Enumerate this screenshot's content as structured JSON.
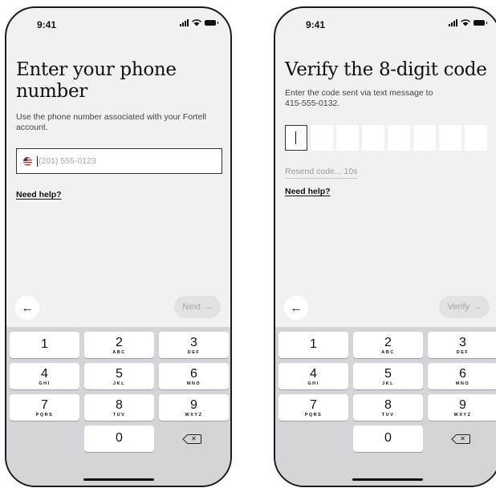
{
  "status": {
    "time": "9:41"
  },
  "screen1": {
    "title": "Enter your phone number",
    "subtitle": "Use the phone number associated with your Fortell account.",
    "flag_icon": "us-flag-icon",
    "phone_placeholder": "(201) 555-0123",
    "need_help": "Need help?",
    "back_icon": "←",
    "next_label": "Next",
    "next_arrow": "→"
  },
  "screen2": {
    "title": "Verify the 8-digit code",
    "subtitle_line1": "Enter the code sent via text message to",
    "subtitle_line2": "415-555-0132.",
    "code_boxes": [
      "",
      "",
      "",
      "",
      "",
      "",
      "",
      ""
    ],
    "resend": "Resend code... 10s",
    "need_help": "Need help?",
    "back_icon": "←",
    "verify_label": "Verify",
    "verify_arrow": "→"
  },
  "keypad": {
    "keys": [
      {
        "num": "1",
        "letters": ""
      },
      {
        "num": "2",
        "letters": "ABC"
      },
      {
        "num": "3",
        "letters": "DEF"
      },
      {
        "num": "4",
        "letters": "GHI"
      },
      {
        "num": "5",
        "letters": "JKL"
      },
      {
        "num": "6",
        "letters": "MNO"
      },
      {
        "num": "7",
        "letters": "PQRS"
      },
      {
        "num": "8",
        "letters": "TUV"
      },
      {
        "num": "9",
        "letters": "WXYZ"
      },
      {
        "num": "0",
        "letters": ""
      }
    ],
    "delete_icon": "backspace-icon",
    "delete_glyph": "✕"
  },
  "colors": {
    "screen_bg": "#f1f1f1",
    "keypad_bg": "#d3d5d9",
    "disabled_button_bg": "#e2e2e2",
    "disabled_text": "#a6a6a6"
  }
}
